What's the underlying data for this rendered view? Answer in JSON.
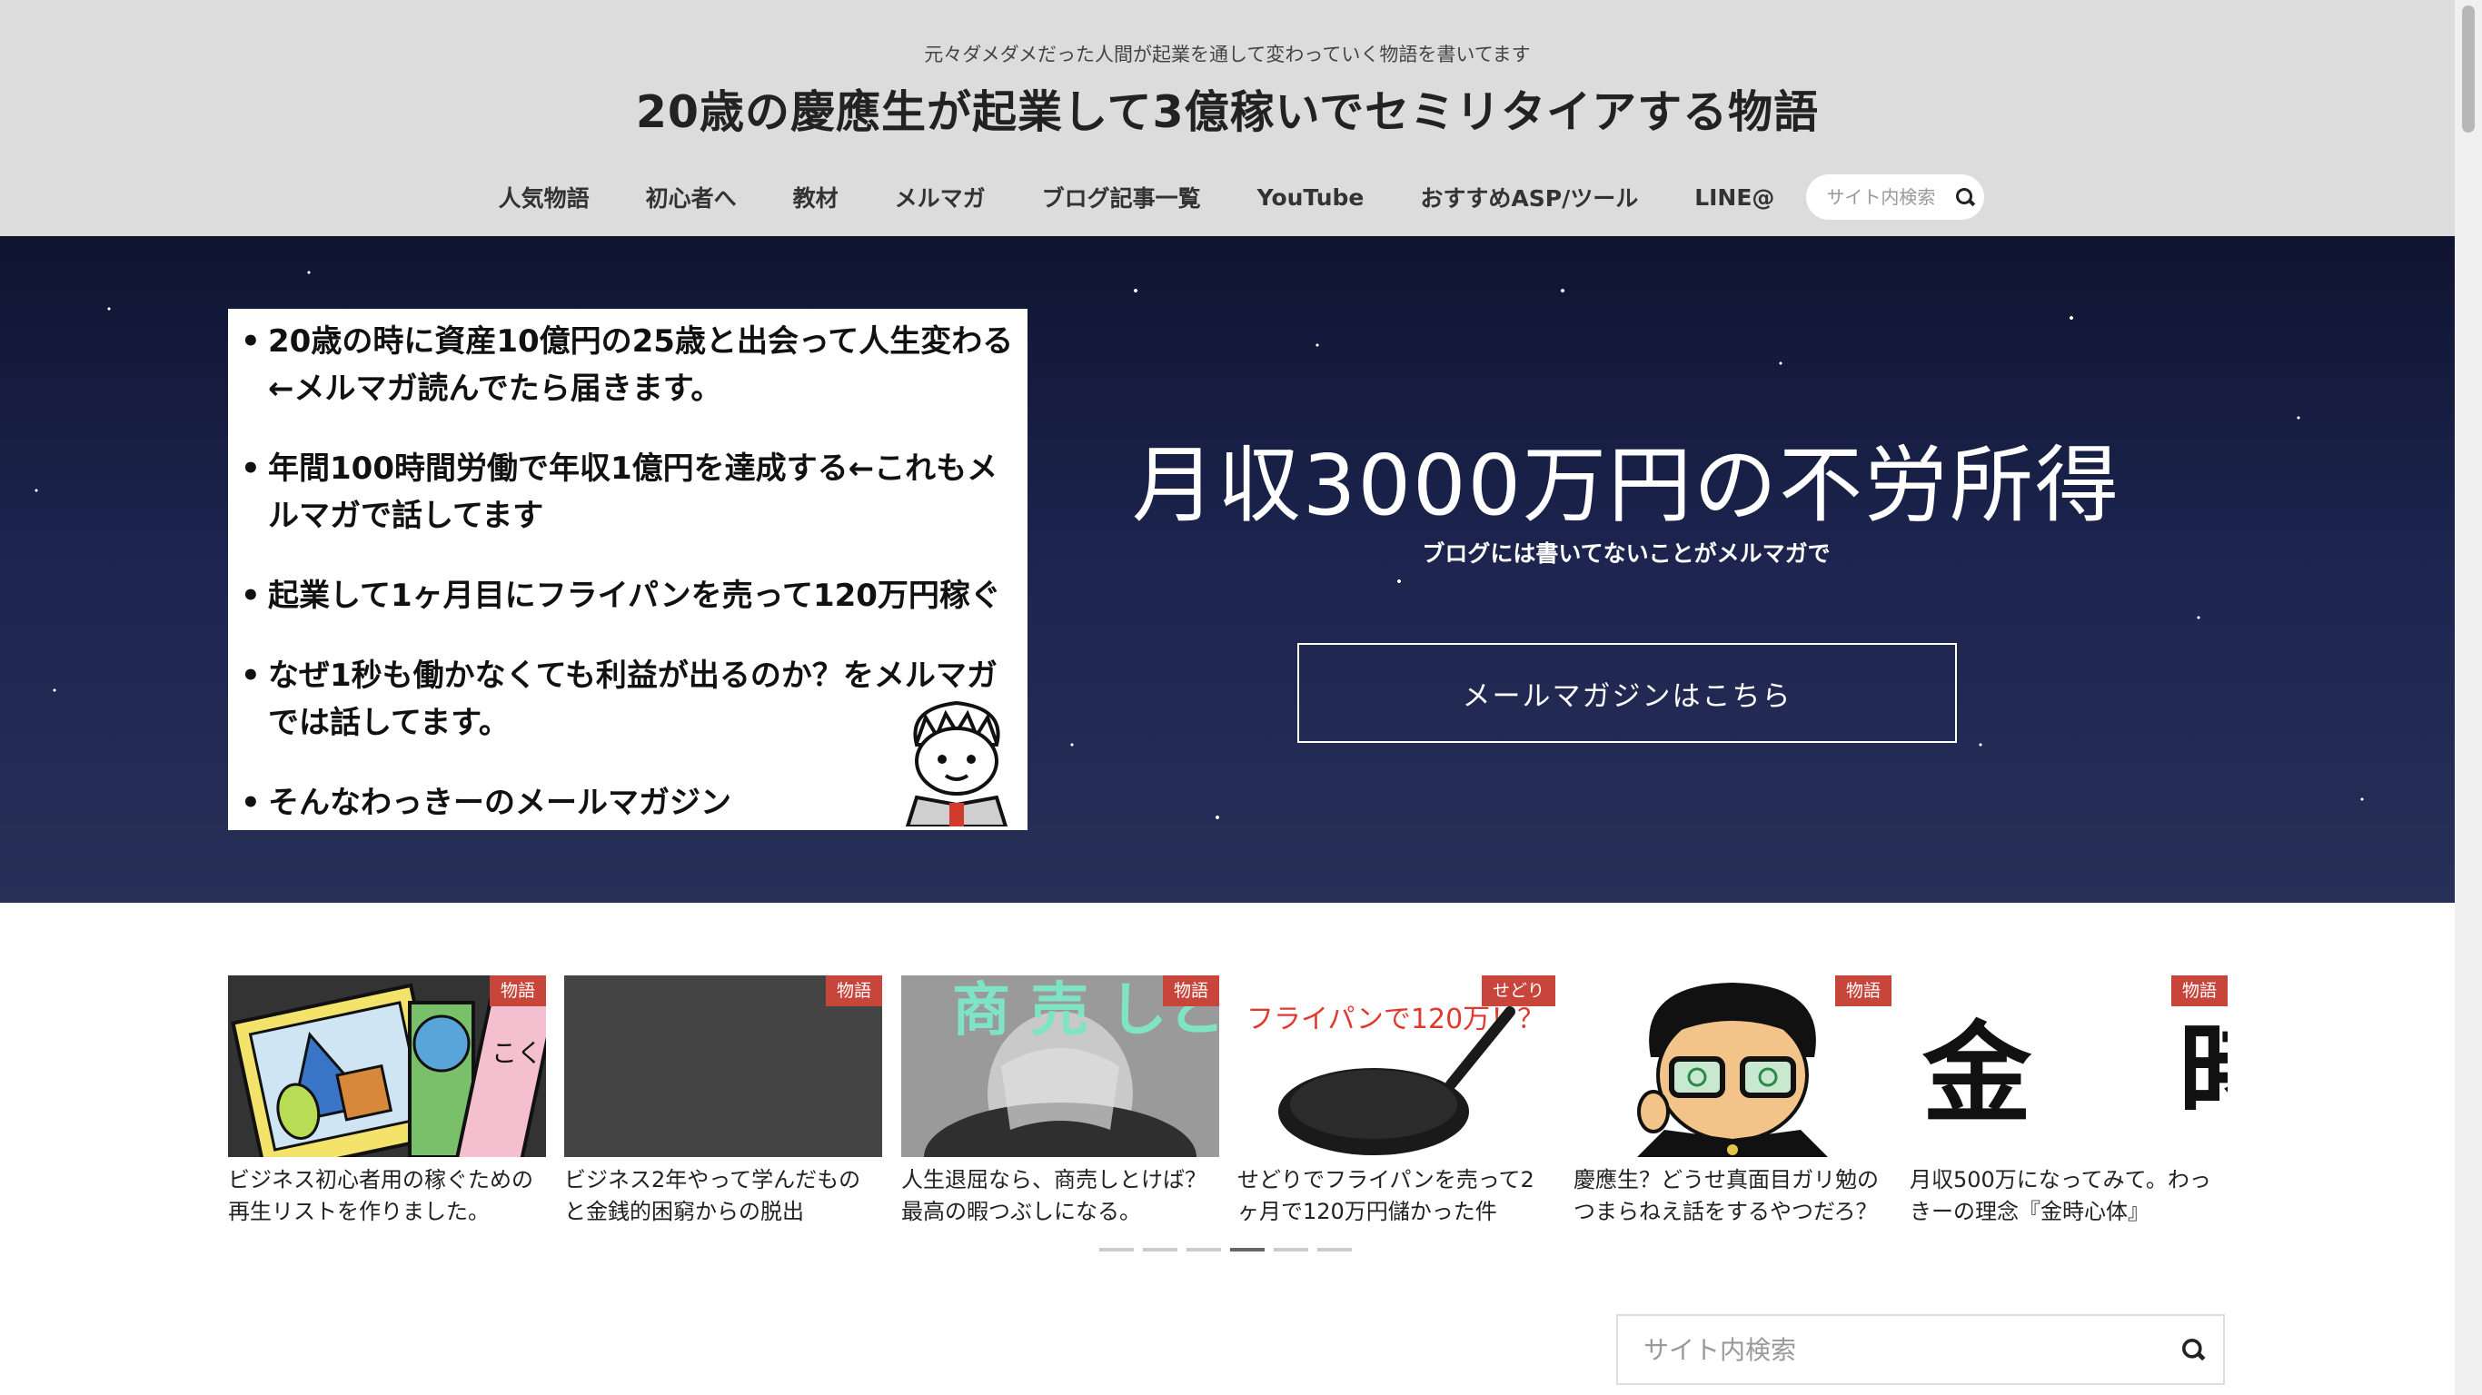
{
  "header": {
    "tagline": "元々ダメダメだった人間が起業を通して変わっていく物語を書いてます",
    "title": "20歳の慶應生が起業して3億稼いでセミリタイアする物語"
  },
  "nav": {
    "items": [
      {
        "label": "人気物語"
      },
      {
        "label": "初心者へ"
      },
      {
        "label": "教材"
      },
      {
        "label": "メルマガ"
      },
      {
        "label": "ブログ記事一覧"
      },
      {
        "label": "YouTube"
      },
      {
        "label": "おすすめASP/ツール"
      },
      {
        "label": "LINE@"
      }
    ],
    "search_placeholder": "サイト内検索"
  },
  "hero": {
    "promo_items": [
      "20歳の時に資産10億円の25歳と出会って人生変わる←メルマガ読んでたら届きます。",
      "年間100時間労働で年収1億円を達成する←これもメルマガで話してます",
      "起業して1ヶ月目にフライパンを売って120万円稼ぐ",
      "なぜ1秒も働かなくても利益が出るのか？をメルマガでは話してます。",
      "そんなわっきーのメールマガジン"
    ],
    "title": "月収3000万円の不労所得",
    "subtitle": "ブログには書いてないことがメルマガで",
    "button_label": "メールマガジンはこちら"
  },
  "carousel": {
    "cards": [
      {
        "category": "物語",
        "title": "ビジネス初心者用の稼ぐための再生リストを作りました。",
        "thumb_text": "こくご さんすう"
      },
      {
        "category": "物語",
        "title": "ビジネス2年やって学んだものと金銭的困窮からの脱出",
        "thumb_text": ""
      },
      {
        "category": "物語",
        "title": "人生退屈なら、商売しとけば？最高の暇つぶしになる。",
        "thumb_text": "商 売 しとけば？"
      },
      {
        "category": "せどり",
        "title": "せどりでフライパンを売って2ヶ月で120万円儲かった件",
        "thumb_text": "フライパンで120万！？"
      },
      {
        "category": "物語",
        "title": "慶應生？どうせ真面目ガリ勉のつまらねえ話をするやつだろ？",
        "thumb_text": ""
      },
      {
        "category": "物語",
        "title": "月収500万になってみて。わっきーの理念『金時心体』",
        "thumb_text": "金 時"
      }
    ],
    "dots": 6,
    "active_dot": 4
  },
  "sidebar": {
    "search_placeholder": "サイト内検索"
  },
  "colors": {
    "header_bg": "#dcdcdc",
    "category_badge": "#c8453c",
    "hero_bg": "#1a1f3c"
  }
}
